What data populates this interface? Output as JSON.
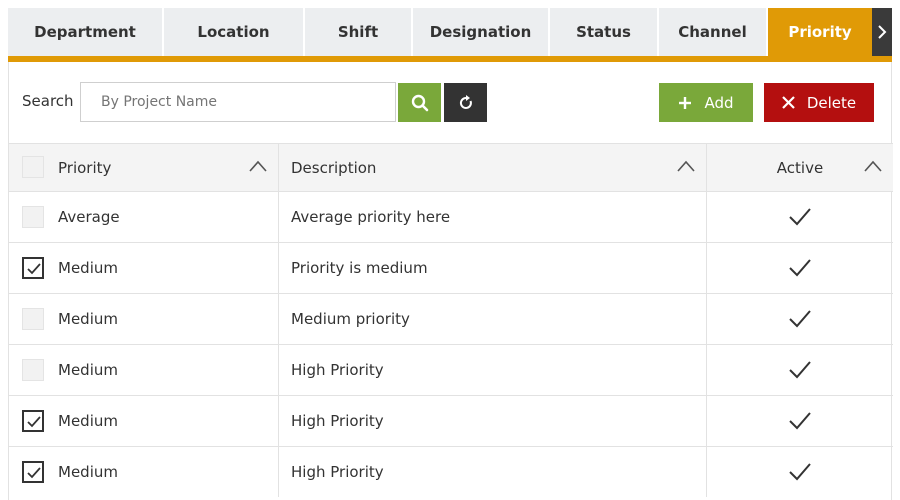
{
  "theme": {
    "accent": "#e09a06",
    "add_green": "#7aa83a",
    "delete_red": "#b40f0f",
    "dark": "#333333"
  },
  "tabs": [
    {
      "label": "Department",
      "active": false
    },
    {
      "label": "Location",
      "active": false
    },
    {
      "label": "Shift",
      "active": false
    },
    {
      "label": "Designation",
      "active": false
    },
    {
      "label": "Status",
      "active": false
    },
    {
      "label": "Channel",
      "active": false
    },
    {
      "label": "Priority",
      "active": true
    }
  ],
  "tab_next_icon": "chevron-right-icon",
  "search": {
    "label": "Search",
    "placeholder": "By Project Name",
    "value": ""
  },
  "toolbar": {
    "add_label": "Add",
    "delete_label": "Delete",
    "search_icon": "search-icon",
    "refresh_icon": "refresh-icon"
  },
  "table": {
    "columns": [
      "Priority",
      "Description",
      "Active"
    ],
    "rows": [
      {
        "priority": "Average",
        "description": "Average priority here",
        "selected": false,
        "active": true
      },
      {
        "priority": "Medium",
        "description": "Priority is medium",
        "selected": true,
        "active": true
      },
      {
        "priority": "Medium",
        "description": "Medium priority",
        "selected": false,
        "active": true
      },
      {
        "priority": "Medium",
        "description": "High Priority",
        "selected": false,
        "active": true
      },
      {
        "priority": "Medium",
        "description": "High Priority",
        "selected": true,
        "active": true
      },
      {
        "priority": "Medium",
        "description": "High Priority",
        "selected": true,
        "active": true
      }
    ]
  }
}
